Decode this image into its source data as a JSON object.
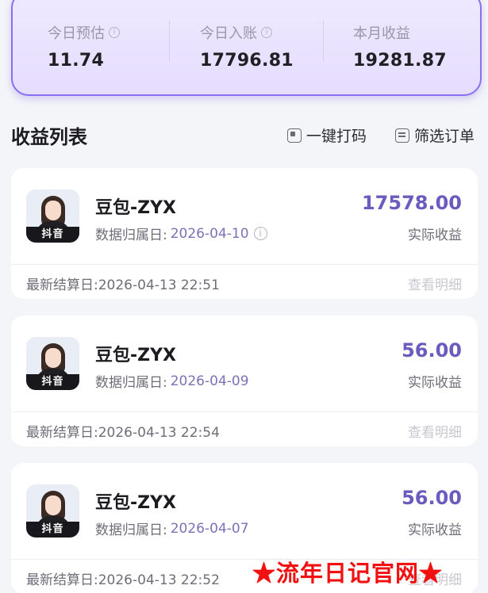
{
  "summary": {
    "stats": [
      {
        "label": "今日预估",
        "value": "11.74",
        "info": "i"
      },
      {
        "label": "今日入账",
        "value": "17796.81",
        "info": "i"
      },
      {
        "label": "本月收益",
        "value": "19281.87"
      }
    ]
  },
  "list": {
    "title": "收益列表",
    "actions": [
      {
        "label": "一键打码",
        "icon": "code-icon"
      },
      {
        "label": "筛选订单",
        "icon": "filter-icon"
      }
    ]
  },
  "cards": [
    {
      "platform_tag": "抖音",
      "name": "豆包-ZYX",
      "date_label": "数据归属日:",
      "date": "2026-04-10",
      "info": "i",
      "amount": "17578.00",
      "amount_label": "实际收益",
      "settle": "最新结算日:2026-04-13 22:51",
      "detail": "查看明细"
    },
    {
      "platform_tag": "抖音",
      "name": "豆包-ZYX",
      "date_label": "数据归属日:",
      "date": "2026-04-09",
      "amount": "56.00",
      "amount_label": "实际收益",
      "settle": "最新结算日:2026-04-13 22:54",
      "detail": "查看明细"
    },
    {
      "platform_tag": "抖音",
      "name": "豆包-ZYX",
      "date_label": "数据归属日:",
      "date": "2026-04-07",
      "amount": "56.00",
      "amount_label": "实际收益",
      "settle": "最新结算日:2026-04-13 22:52",
      "detail": "查看明细"
    }
  ],
  "watermark": "★流年日记官网★",
  "colors": {
    "accent": "#6a5bbf",
    "summary_border": "#8a6ff0",
    "watermark": "#f21111"
  }
}
